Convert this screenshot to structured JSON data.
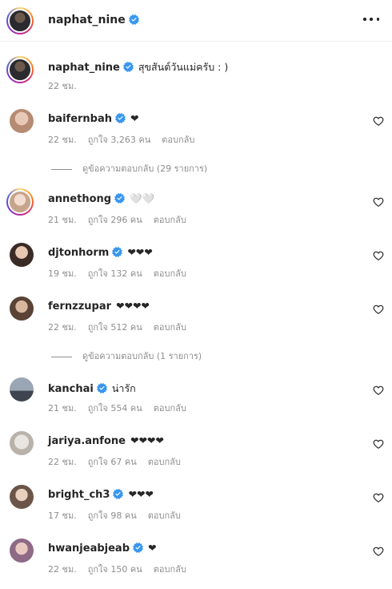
{
  "header": {
    "username": "naphat_nine"
  },
  "caption": {
    "username": "naphat_nine",
    "text": "สุขสันต์วันแม่ครับ : )",
    "time": "22 ชม."
  },
  "comments": [
    {
      "username": "baifernbah",
      "verified": true,
      "text": "❤",
      "time": "22 ชม.",
      "likes": "ถูกใจ 3,263 คน",
      "reply": "ตอบกลับ",
      "replies_label": "ดูข้อความตอบกลับ (29 รายการ)"
    },
    {
      "username": "annethong",
      "verified": true,
      "text": "🤍🤍",
      "time": "21 ชม.",
      "likes": "ถูกใจ 296 คน",
      "reply": "ตอบกลับ"
    },
    {
      "username": "djtonhorm",
      "verified": true,
      "text": "❤❤❤",
      "time": "19 ชม.",
      "likes": "ถูกใจ 132 คน",
      "reply": "ตอบกลับ"
    },
    {
      "username": "fernzzupar",
      "verified": false,
      "text": "❤❤❤❤",
      "time": "22 ชม.",
      "likes": "ถูกใจ 512 คน",
      "reply": "ตอบกลับ",
      "replies_label": "ดูข้อความตอบกลับ (1 รายการ)"
    },
    {
      "username": "kanchai",
      "verified": true,
      "text": "น่ารัก",
      "time": "21 ชม.",
      "likes": "ถูกใจ 554 คน",
      "reply": "ตอบกลับ"
    },
    {
      "username": "jariya.anfone",
      "verified": false,
      "text": "❤❤❤❤",
      "time": "22 ชม.",
      "likes": "ถูกใจ 67 คน",
      "reply": "ตอบกลับ"
    },
    {
      "username": "bright_ch3",
      "verified": true,
      "text": "❤❤❤",
      "time": "17 ชม.",
      "likes": "ถูกใจ 98 คน",
      "reply": "ตอบกลับ"
    },
    {
      "username": "hwanjeabjeab",
      "verified": true,
      "text": "❤",
      "time": "22 ชม.",
      "likes": "ถูกใจ 150 คน",
      "reply": "ตอบกลับ"
    }
  ],
  "colors": {
    "verified": "#3897f0",
    "meta": "#8e8e8e",
    "text": "#262626"
  }
}
